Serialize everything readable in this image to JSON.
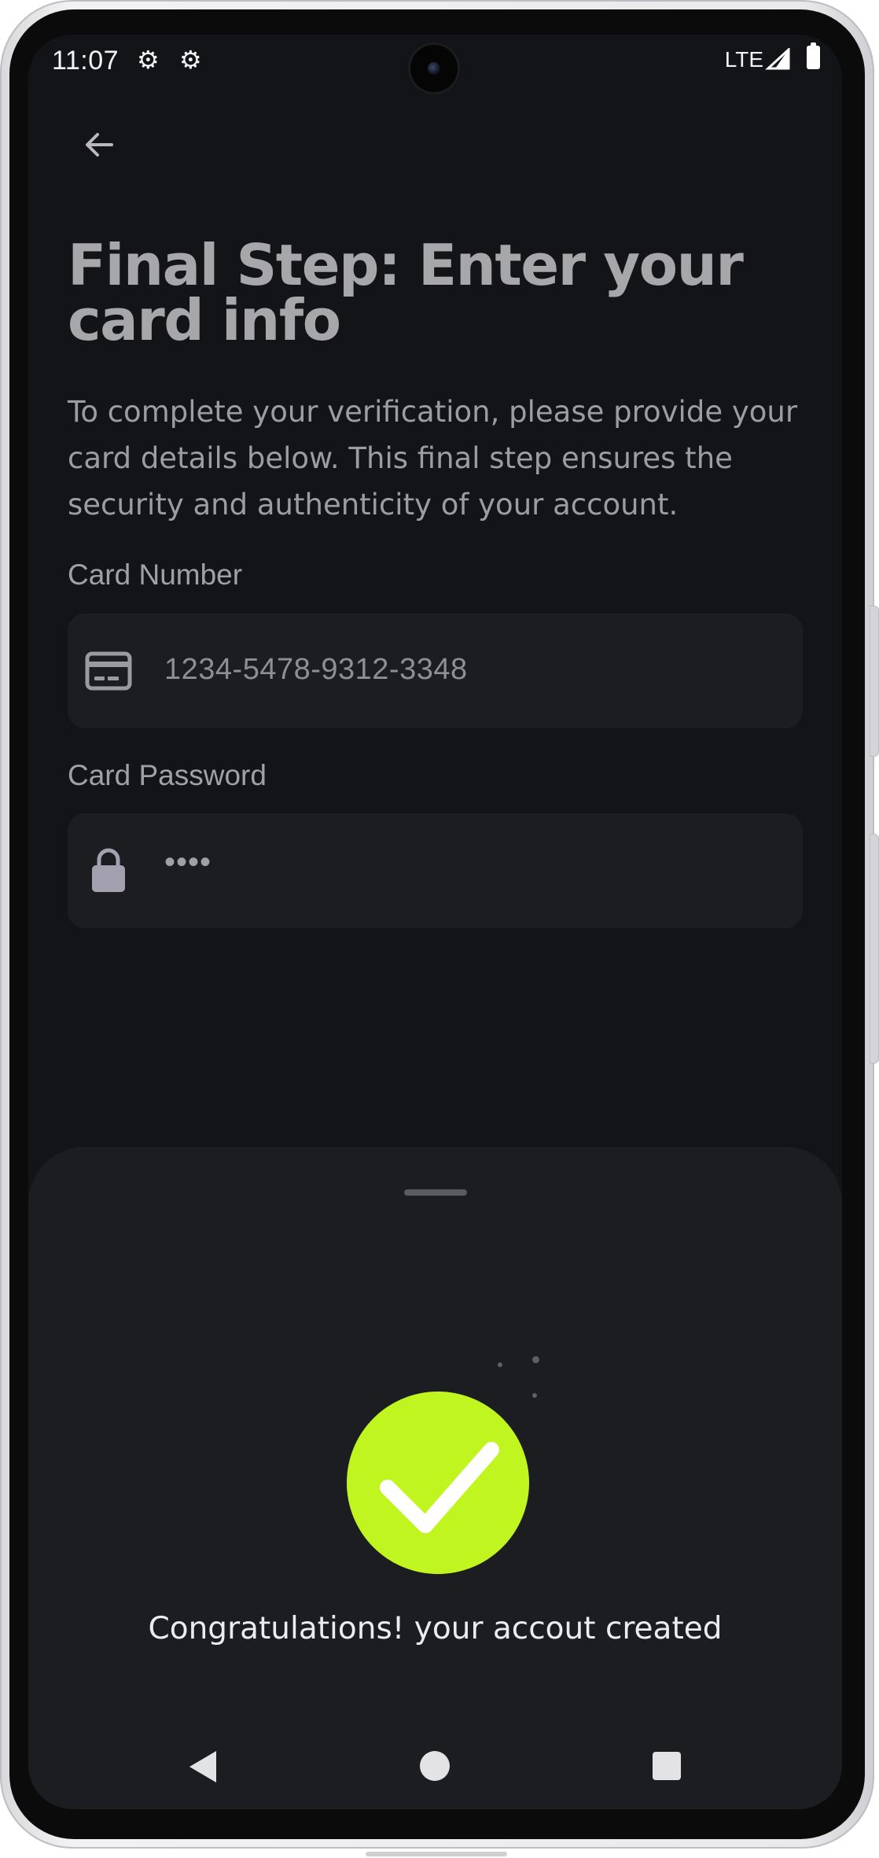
{
  "status_bar": {
    "time": "11:07",
    "network": "LTE",
    "icons": [
      "settings-gear-icon",
      "settings-gear-icon",
      "signal-icon",
      "battery-icon"
    ]
  },
  "header": {
    "back_icon": "arrow-left-icon"
  },
  "page": {
    "title": "Final Step: Enter your card info",
    "description": "To complete your verification, please provide your card details below. This final step ensures the security and authenticity of your account."
  },
  "form": {
    "card_number": {
      "label": "Card Number",
      "value": "1234-5478-9312-3348",
      "icon": "credit-card-icon"
    },
    "card_password": {
      "label": "Card Password",
      "value": "••••",
      "icon": "lock-icon"
    }
  },
  "sheet": {
    "icon": "checkmark-icon",
    "accent_color": "#c0f520",
    "message": "Congratulations! your accout created"
  },
  "nav": {
    "icons": [
      "nav-back-icon",
      "nav-home-icon",
      "nav-recents-icon"
    ]
  }
}
